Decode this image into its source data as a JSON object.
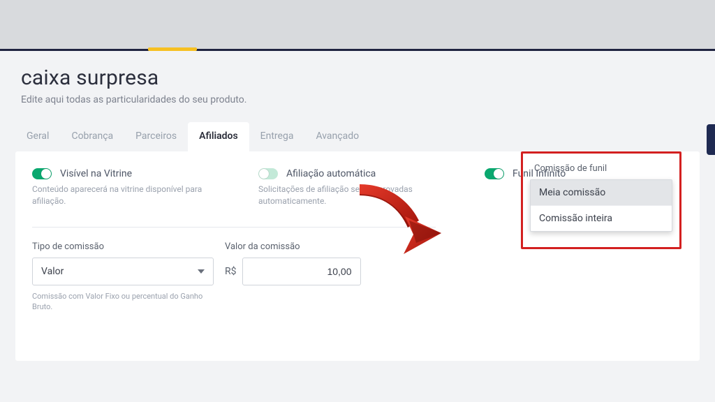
{
  "header": {
    "title": "caixa surpresa",
    "subtitle": "Edite aqui todas as particularidades do seu produto."
  },
  "tabs": [
    {
      "label": "Geral"
    },
    {
      "label": "Cobrança"
    },
    {
      "label": "Parceiros"
    },
    {
      "label": "Afiliados",
      "active": true
    },
    {
      "label": "Entrega"
    },
    {
      "label": "Avançado"
    }
  ],
  "affiliates": {
    "visible_label": "Visível na Vitrine",
    "visible_desc": "Conteúdo aparecerá na vitrine disponível para afiliação.",
    "auto_label": "Afiliação automática",
    "auto_desc": "Solicitações de afiliação serão aprovadas automaticamente.",
    "funnel_label": "Funil Infinito"
  },
  "commission": {
    "type_label": "Tipo de comissão",
    "type_value": "Valor",
    "type_hint": "Comissão com Valor Fixo ou percentual do Ganho Bruto.",
    "value_label": "Valor da comissão",
    "currency_prefix": "R$",
    "value": "10,00"
  },
  "funnel_commission": {
    "label": "Comissão de funil",
    "options": [
      "Meia comissão",
      "Comissão inteira"
    ],
    "selected": "Meia comissão"
  }
}
